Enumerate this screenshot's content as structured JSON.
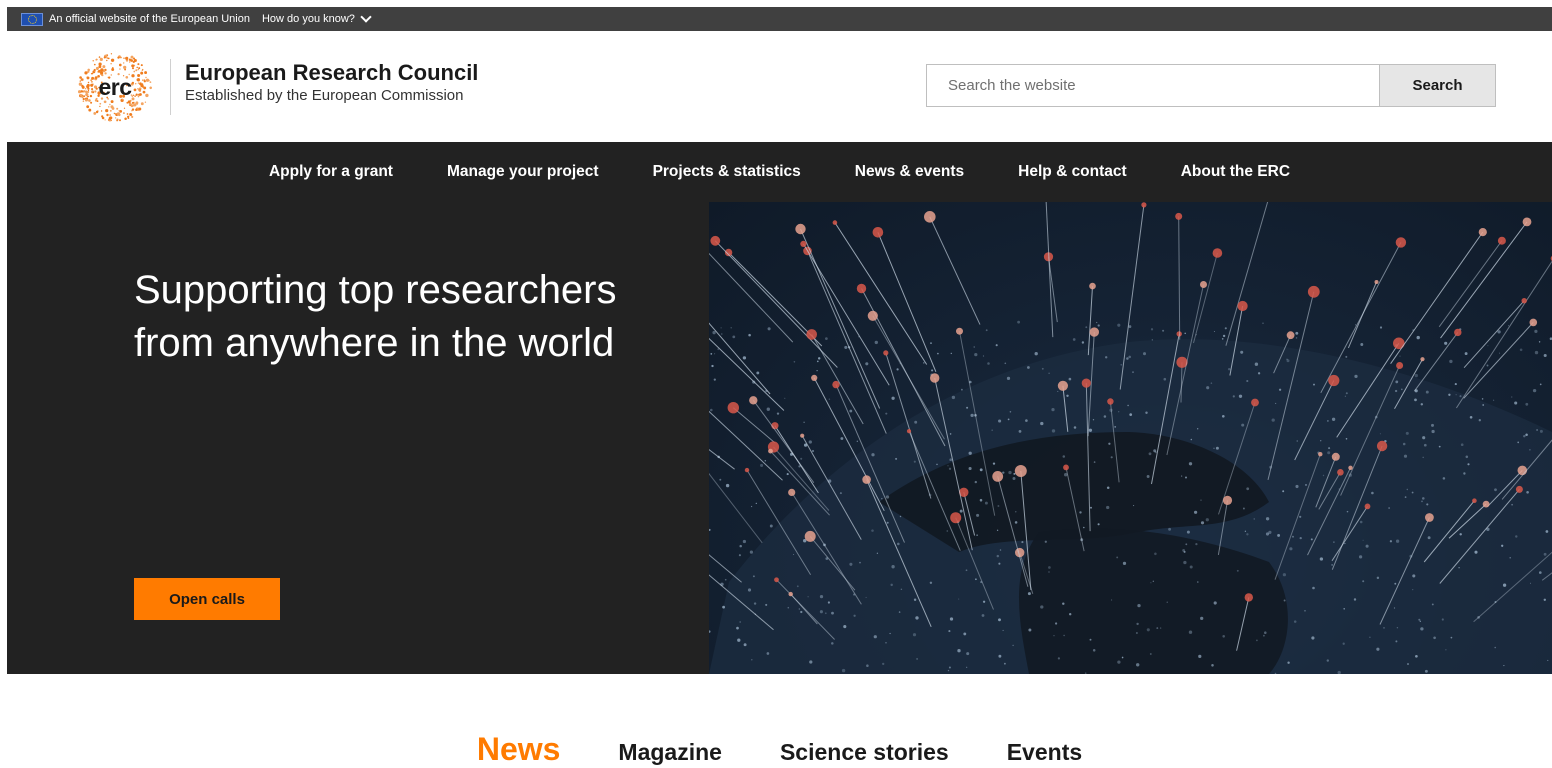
{
  "eu_bar": {
    "official_text": "An official website of the European Union",
    "how_text": "How do you know?"
  },
  "header": {
    "logo_text": "erc",
    "title": "European Research Council",
    "subtitle": "Established by the European Commission",
    "search_placeholder": "Search the website",
    "search_button": "Search"
  },
  "nav": {
    "items": [
      {
        "label": "Apply for a grant"
      },
      {
        "label": "Manage your project"
      },
      {
        "label": "Projects & statistics"
      },
      {
        "label": "News & events"
      },
      {
        "label": "Help & contact"
      },
      {
        "label": "About the ERC"
      }
    ]
  },
  "hero": {
    "title": "Supporting top researchers from anywhere in the world",
    "button": "Open calls"
  },
  "tabs": {
    "items": [
      {
        "label": "News",
        "active": true
      },
      {
        "label": "Magazine"
      },
      {
        "label": "Science stories"
      },
      {
        "label": "Events"
      }
    ]
  },
  "colors": {
    "accent": "#ff7b00",
    "dark": "#222222",
    "eu_bar": "#404040"
  }
}
